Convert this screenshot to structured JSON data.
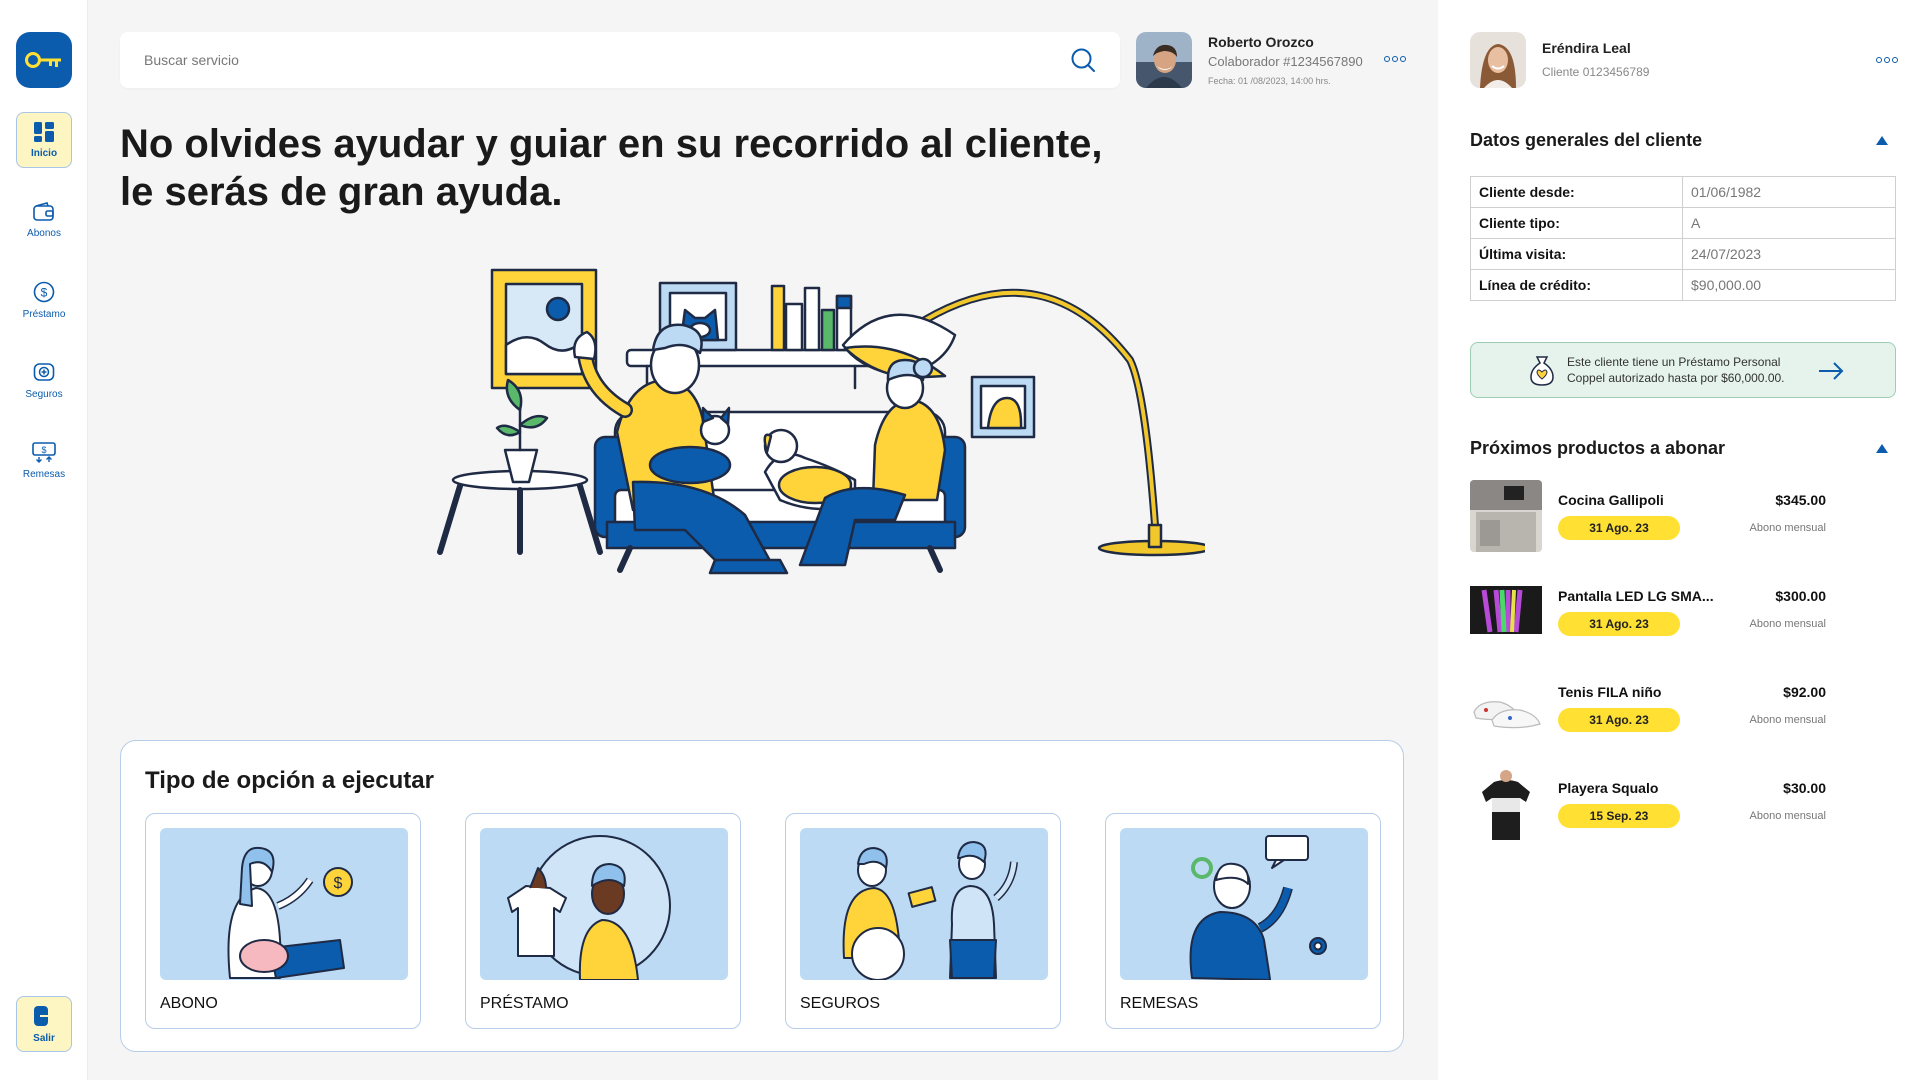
{
  "app": {
    "logo_icon": "key-icon",
    "accent": "#0b5cad",
    "highlight": "#ffe033"
  },
  "sidebar": {
    "items": [
      {
        "label": "Inicio",
        "icon": "dashboard-icon",
        "active": true
      },
      {
        "label": "Abonos",
        "icon": "wallet-icon"
      },
      {
        "label": "Préstamo",
        "icon": "dollar-circle-icon"
      },
      {
        "label": "Seguros",
        "icon": "shield-icon"
      },
      {
        "label": "Remesas",
        "icon": "money-transfer-icon"
      }
    ],
    "logout": {
      "label": "Salir",
      "icon": "logout-icon"
    }
  },
  "search": {
    "placeholder": "Buscar servicio",
    "icon": "search-icon"
  },
  "collaborator": {
    "name": "Roberto Orozco",
    "id": "Colaborador #1234567890",
    "date": "Fecha: 01 /08/2023, 14:00 hrs."
  },
  "headline": {
    "line1": "No olvides ayudar y guiar en su recorrido al cliente,",
    "line2": "le serás de gran ayuda."
  },
  "options": {
    "title": "Tipo de opción a ejecutar",
    "items": [
      {
        "label": "ABONO"
      },
      {
        "label": "PRÉSTAMO"
      },
      {
        "label": "SEGUROS"
      },
      {
        "label": "REMESAS"
      }
    ]
  },
  "client": {
    "name": "Eréndira Leal",
    "id": "Cliente 0123456789",
    "general_title": "Datos generales del cliente",
    "details": [
      {
        "key": "Cliente desde:",
        "value": "01/06/1982"
      },
      {
        "key": "Cliente tipo:",
        "value": "A"
      },
      {
        "key": "Última visita:",
        "value": "24/07/2023"
      },
      {
        "key": "Línea de crédito:",
        "value": "$90,000.00"
      }
    ],
    "notice": "Este cliente tiene un Préstamo Personal Coppel autorizado hasta por $60,000.00."
  },
  "products": {
    "title": "Próximos productos a abonar",
    "items": [
      {
        "name": "Cocina Gallipoli",
        "date": "31 Ago. 23",
        "price": "$345.00",
        "freq": "Abono mensual"
      },
      {
        "name": "Pantalla LED LG SMA...",
        "date": "31 Ago. 23",
        "price": "$300.00",
        "freq": "Abono mensual"
      },
      {
        "name": "Tenis FILA niño",
        "date": "31 Ago. 23",
        "price": "$92.00",
        "freq": "Abono mensual"
      },
      {
        "name": "Playera Squalo",
        "date": "15 Sep. 23",
        "price": "$30.00",
        "freq": "Abono mensual"
      }
    ]
  }
}
